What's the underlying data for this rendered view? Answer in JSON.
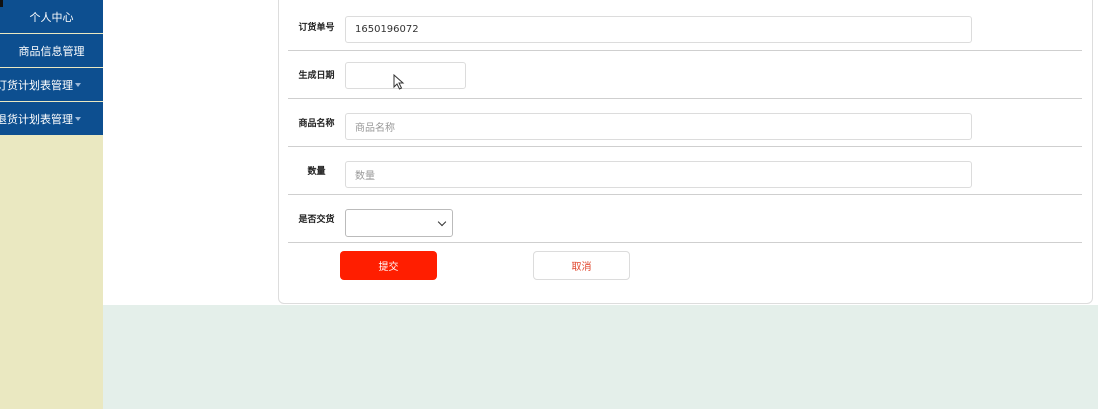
{
  "sidebar": {
    "items": [
      {
        "label": "个人中心"
      },
      {
        "label": "商品信息管理"
      },
      {
        "label": "订货计划表管理"
      },
      {
        "label": "退货计划表管理"
      }
    ]
  },
  "form": {
    "order_no": {
      "label": "订货单号",
      "value": "1650196072"
    },
    "gen_date": {
      "label": "生成日期",
      "value": ""
    },
    "product_name": {
      "label": "商品名称",
      "placeholder": "商品名称"
    },
    "quantity": {
      "label": "数量",
      "placeholder": "数量"
    },
    "delivered": {
      "label": "是否交货",
      "value": ""
    }
  },
  "buttons": {
    "submit": "提交",
    "cancel": "取消"
  },
  "colors": {
    "sidebar_item": "#0d4f90",
    "sidebar_bg": "#eae8c1",
    "submit": "#ff1e00",
    "page_bg": "#e4efea"
  }
}
